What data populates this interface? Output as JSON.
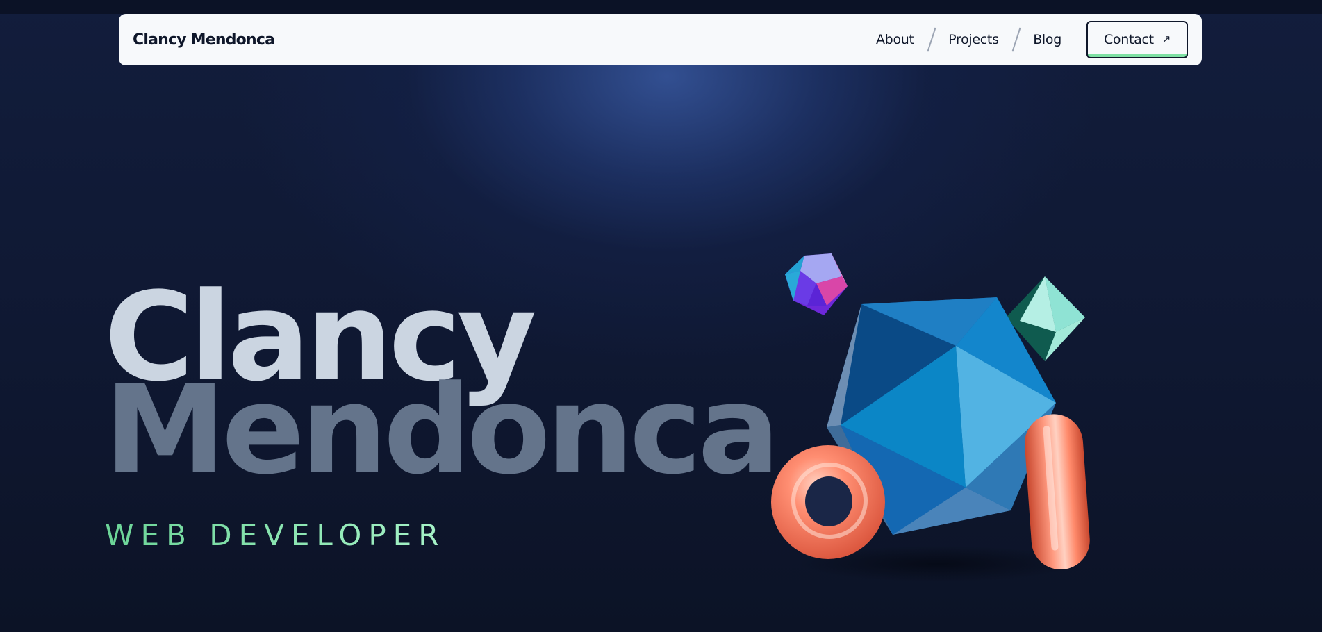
{
  "nav": {
    "brand": "Clancy Mendonca",
    "links": [
      {
        "label": "About"
      },
      {
        "label": "Projects"
      },
      {
        "label": "Blog"
      }
    ],
    "contact_label": "Contact",
    "contact_icon": "arrow-up-right-icon"
  },
  "hero": {
    "first_name": "Clancy",
    "last_name": "Mendonca",
    "role": "WEB DEVELOPER"
  },
  "colors": {
    "background": "#0d1428",
    "nav_bg": "#f7f9fb",
    "first_name": "#cbd5e1",
    "last_name": "#64748b",
    "role_gradient_start": "#6bd497",
    "role_gradient_end": "#a7f3c8",
    "contact_underline": "#7ee0a3"
  }
}
